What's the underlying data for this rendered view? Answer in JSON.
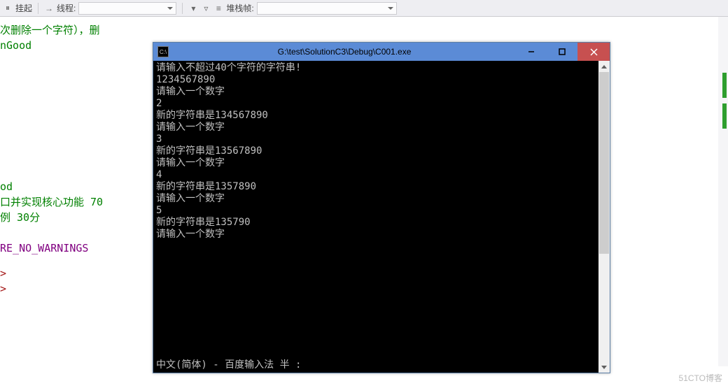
{
  "toolbar": {
    "pause_label": "挂起",
    "thread_label": "线程:",
    "stack_label": "堆栈帧:"
  },
  "code": {
    "line1": "次删除一个字符），删",
    "line2": "nGood",
    "line3": "od",
    "line4": "口并实现核心功能 70",
    "line5": "例 30分",
    "line6": "RE_NO_WARNINGS",
    "line7": ">",
    "line8": ">"
  },
  "console": {
    "title": "G:\\test\\SolutionC3\\Debug\\C001.exe",
    "lines": [
      "请输入不超过40个字符的字符串!",
      "1234567890",
      "请输入一个数字",
      "2",
      "新的字符串是134567890",
      "请输入一个数字",
      "3",
      "新的字符串是13567890",
      "请输入一个数字",
      "4",
      "新的字符串是1357890",
      "请输入一个数字",
      "5",
      "新的字符串是135790",
      "请输入一个数字"
    ],
    "ime": "中文(简体) - 百度输入法 半 :"
  },
  "watermark": "51CTO博客"
}
